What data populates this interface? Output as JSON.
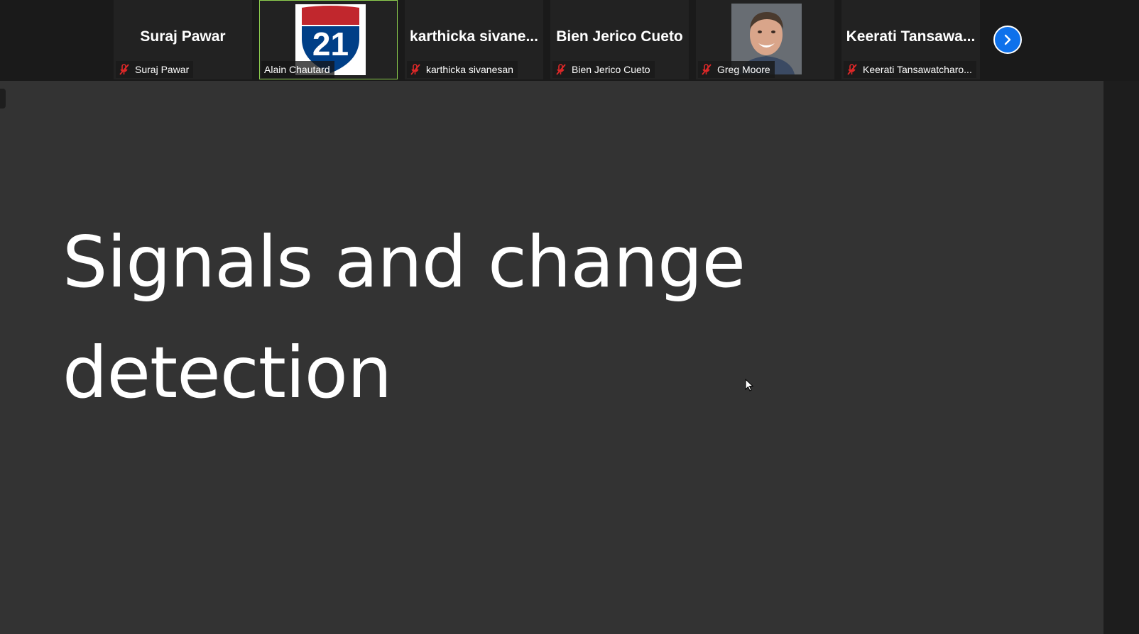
{
  "participants": [
    {
      "display_name": "Suraj Pawar",
      "label": "Suraj Pawar",
      "muted": true,
      "media": "name"
    },
    {
      "display_name": "",
      "label": "Alain Chautard",
      "muted": false,
      "media": "interstate-21-shield",
      "shield_number": "21"
    },
    {
      "display_name": "karthicka  sivane...",
      "label": "karthicka sivanesan",
      "muted": true,
      "media": "name"
    },
    {
      "display_name": "Bien Jerico Cueto",
      "label": "Bien Jerico Cueto",
      "muted": true,
      "media": "name"
    },
    {
      "display_name": "",
      "label": "Greg Moore",
      "muted": true,
      "media": "profile-photo"
    },
    {
      "display_name": "Keerati  Tansawa...",
      "label": "Keerati Tansawatcharo...",
      "muted": true,
      "media": "name"
    }
  ],
  "next_button": {
    "icon": "chevron-right-icon"
  },
  "slide": {
    "title_line1": "Signals and change",
    "title_line2": "detection"
  },
  "colors": {
    "slide_bg": "#333333",
    "strip_bg": "#1a1a1a",
    "active_border": "#8fd14f",
    "mute_red": "#e02828",
    "accent_blue": "#0e71eb"
  }
}
